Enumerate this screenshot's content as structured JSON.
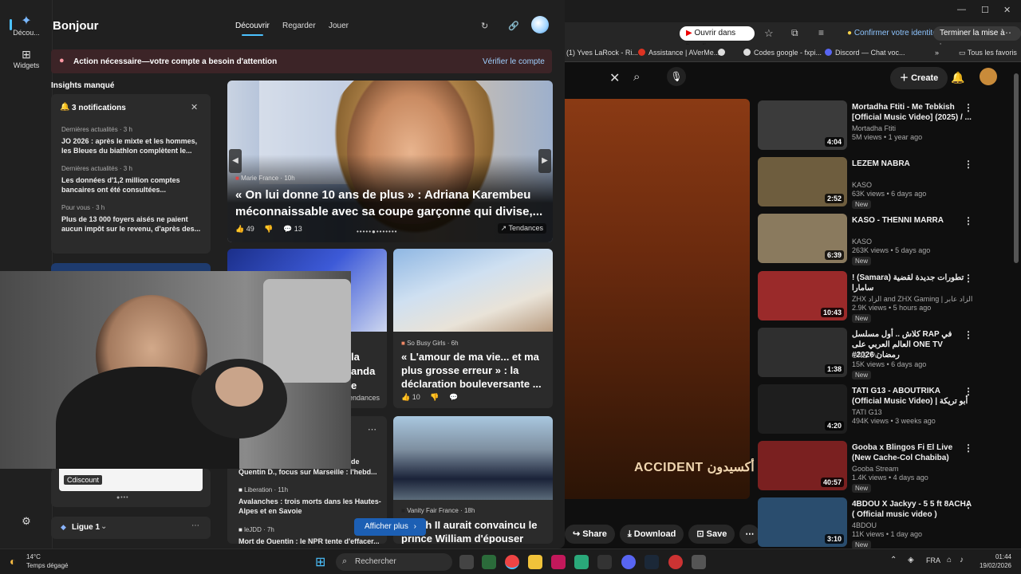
{
  "widgets": {
    "rail": {
      "decouvrir": "Décou...",
      "widgets": "Widgets"
    },
    "greeting": "Bonjour",
    "tabs": [
      "Découvrir",
      "Regarder",
      "Jouer"
    ],
    "alert": {
      "text": "Action nécessaire—votre compte a besoin d'attention",
      "link": "Vérifier le compte"
    },
    "insights_title": "Insights manqué",
    "notifications": {
      "header": "3 notifications",
      "items": [
        {
          "source": "Dernières actualités · 3 h",
          "text": "JO 2026 : après le mixte et les hommes, les Bleues du biathlon complètent le..."
        },
        {
          "source": "Dernières actualités · 3 h",
          "text": "Les données d'1,2 million comptes bancaires ont été consultées..."
        },
        {
          "source": "Pour vous · 3 h",
          "text": "Plus de 13 000 foyers aisés ne paient aucun impôt sur le revenu, d'après des..."
        }
      ]
    },
    "hero": {
      "source": "Marie France",
      "time": "10h",
      "title": "« On lui donne 10 ans de plus » : Adriana Karembeu méconnaissable avec sa coupe garçonne qui divise,...",
      "likes": "49",
      "comments": "13",
      "badge": "Tendances"
    },
    "card2": {
      "source": "So Busy Girls",
      "time": "6h",
      "title": "« L'amour de ma vie... et ma plus grosse erreur » : la déclaration bouleversante ...",
      "likes": "10"
    },
    "card_left_partial": {
      "line1": "la",
      "line2": "anda",
      "line3": "e",
      "badge": "endances"
    },
    "stories": [
      {
        "tail": "de",
        "text": "Quentin D., focus sur Marseille : l'hebd..."
      },
      {
        "source": "Liberation · 11h",
        "text": "Avalanches : trois morts dans les Hautes-Alpes et en Savoie"
      },
      {
        "source": "leJDD · 7h",
        "text": "Mort de Quentin : le NPR tente d'effacer..."
      }
    ],
    "card3": {
      "source": "Vanity Fair France",
      "time": "18h",
      "title": "...beth II aurait convaincu le prince William d'épouser"
    },
    "shop_label": "Cdiscount",
    "league": "Ligue 1",
    "more_button": "Afficher plus"
  },
  "browser": {
    "open_in_app": "Ouvrir dans l'appli",
    "confirm_identity": "Confirmer votre identité",
    "update": "Terminer la mise à jour",
    "bookmarks": [
      "(1) Yves LaRock - Ri...",
      "Assistance | AVerMe...",
      "Codes google - fxpi...",
      "Discord — Chat voc...",
      "Tous les favoris"
    ],
    "create": "Create",
    "video_title": "ACCIDENT أكسيدون",
    "actions": [
      "Share",
      "Download",
      "Save"
    ],
    "recommendations": [
      {
        "title": "Mortadha Ftiti - Me Tebkish [Official Music Video] (2025) / ...",
        "channel": "Mortadha Ftiti",
        "meta": "5M views • 1 year ago",
        "duration": "4:04",
        "new": "",
        "color": "#3b3b3b"
      },
      {
        "title": "LEZEM NABRA",
        "channel": "KASO",
        "meta": "63K views • 6 days ago",
        "duration": "2:52",
        "new": "New",
        "color": "#6e5d3e"
      },
      {
        "title": "KASO - THENNI MARRA",
        "channel": "KASO",
        "meta": "263K views • 5 days ago",
        "duration": "6:39",
        "new": "New",
        "color": "#8a7a5e"
      },
      {
        "title": "! (Samara) تطورات جديدة لقضية سامارا",
        "channel": "ZHX الزاد and ZHX Gaming | الزاد عابر",
        "meta": "2.9K views • 5 hours ago",
        "duration": "10:43",
        "new": "New",
        "color": "#9a2a2a"
      },
      {
        "title": "كلاش .. أول مسلسل RAP في العالم العربي على ONE TV #رمضان 2026",
        "channel": "ONE TV",
        "meta": "15K views • 6 days ago",
        "duration": "1:38",
        "new": "New",
        "color": "#2f2f2f"
      },
      {
        "title": "TATI G13 - ABOUTRIKA (Official Music Video) | أبو تريكة",
        "channel": "TATI G13",
        "meta": "494K views • 3 weeks ago",
        "duration": "4:20",
        "new": "",
        "color": "#1e1e1e"
      },
      {
        "title": "Gooba x Blingos Fi El Live (New Cache-Col Chabiba)",
        "channel": "Gooba Stream",
        "meta": "1.4K views • 4 days ago",
        "duration": "40:57",
        "new": "New",
        "color": "#7a2020"
      },
      {
        "title": "4BDOU X Jackyy - 5 5 ft 8ACHA ( Official music video )",
        "channel": "4BDOU",
        "meta": "11K views • 1 day ago",
        "duration": "3:10",
        "new": "New",
        "color": "#2a4d6e"
      }
    ]
  },
  "taskbar": {
    "weather_temp": "14°C",
    "weather_desc": "Temps dégagé",
    "search_placeholder": "Rechercher",
    "lang": "FRA",
    "time": "01:44",
    "date": "19/02/2026"
  }
}
